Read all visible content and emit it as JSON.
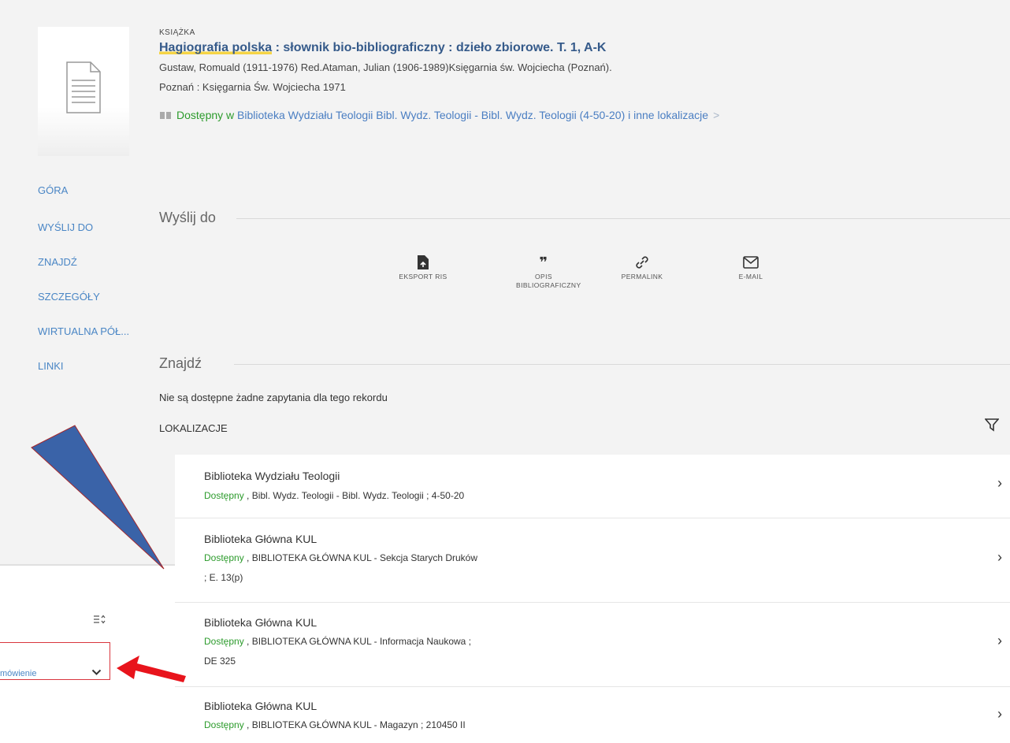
{
  "record": {
    "type": "KSIĄŻKA",
    "title_highlight": "Hagiografia polska",
    "title_rest": " : słownik bio-bibliograficzny : dzieło zbiorowe. T. 1, A-K",
    "authors": "Gustaw, Romuald (1911-1976) Red.Ataman, Julian (1906-1989)Księgarnia św. Wojciecha (Poznań).",
    "publication": "Poznań : Księgarnia Św. Wojciecha 1971",
    "availability_status": "Dostępny w",
    "availability_location": "Biblioteka Wydziału Teologii  Bibl. Wydz. Teologii - Bibl. Wydz. Teologii (4-50-20) i inne lokalizacje",
    "availability_arrow": ">"
  },
  "nav": {
    "items": [
      "GÓRA",
      "WYŚLIJ DO",
      "ZNAJDŹ",
      "SZCZEGÓŁY",
      "WIRTUALNA PÓŁ...",
      "LINKI"
    ]
  },
  "send_to": {
    "heading": "Wyślij do",
    "actions": [
      {
        "label": "EKSPORT RIS",
        "icon": "ris-export-icon"
      },
      {
        "label": "OPIS BIBLIOGRAFICZNY",
        "icon": "quote-icon"
      },
      {
        "label": "PERMALINK",
        "icon": "link-icon"
      },
      {
        "label": "E-MAIL",
        "icon": "email-icon"
      }
    ]
  },
  "find": {
    "heading": "Znajdź",
    "empty_text": "Nie są dostępne żadne zapytania dla tego rekordu"
  },
  "locations": {
    "label": "LOKALIZACJE",
    "items": [
      {
        "library": "Biblioteka Wydziału Teologii",
        "status": "Dostępny",
        "line1": " , Bibl. Wydz. Teologii - Bibl. Wydz. Teologii ; 4-50-20",
        "line2": ""
      },
      {
        "library": "Biblioteka Główna KUL",
        "status": "Dostępny",
        "line1": " , BIBLIOTEKA GŁÓWNA KUL - Sekcja Starych Druków",
        "line2": "; E. 13(p)"
      },
      {
        "library": "Biblioteka Główna KUL",
        "status": "Dostępny",
        "line1": " , BIBLIOTEKA GŁÓWNA KUL - Informacja Naukowa ;",
        "line2": "DE 325"
      },
      {
        "library": "Biblioteka Główna KUL",
        "status": "Dostępny",
        "line1": " , BIBLIOTEKA GŁÓWNA KUL - Magazyn ; 210450 II",
        "line2": ""
      }
    ]
  },
  "order_panel": {
    "select_label": "mówienie"
  },
  "colors": {
    "link": "#355a8a",
    "available": "#2c9b2c",
    "annotation_arrow": "#e8141c",
    "annotation_callout": "#3a63a8"
  }
}
